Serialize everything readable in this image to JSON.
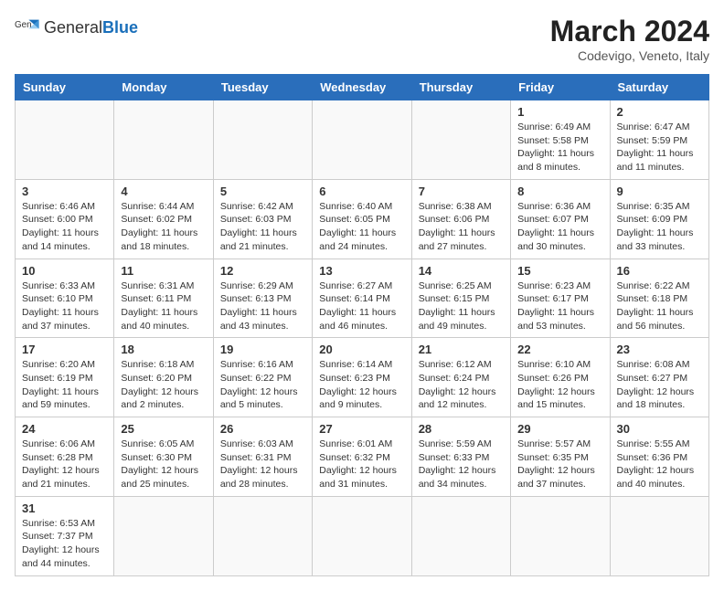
{
  "header": {
    "logo_general": "General",
    "logo_blue": "Blue",
    "month_title": "March 2024",
    "subtitle": "Codevigo, Veneto, Italy"
  },
  "weekdays": [
    "Sunday",
    "Monday",
    "Tuesday",
    "Wednesday",
    "Thursday",
    "Friday",
    "Saturday"
  ],
  "weeks": [
    [
      {
        "day": "",
        "info": ""
      },
      {
        "day": "",
        "info": ""
      },
      {
        "day": "",
        "info": ""
      },
      {
        "day": "",
        "info": ""
      },
      {
        "day": "",
        "info": ""
      },
      {
        "day": "1",
        "info": "Sunrise: 6:49 AM\nSunset: 5:58 PM\nDaylight: 11 hours and 8 minutes."
      },
      {
        "day": "2",
        "info": "Sunrise: 6:47 AM\nSunset: 5:59 PM\nDaylight: 11 hours and 11 minutes."
      }
    ],
    [
      {
        "day": "3",
        "info": "Sunrise: 6:46 AM\nSunset: 6:00 PM\nDaylight: 11 hours and 14 minutes."
      },
      {
        "day": "4",
        "info": "Sunrise: 6:44 AM\nSunset: 6:02 PM\nDaylight: 11 hours and 18 minutes."
      },
      {
        "day": "5",
        "info": "Sunrise: 6:42 AM\nSunset: 6:03 PM\nDaylight: 11 hours and 21 minutes."
      },
      {
        "day": "6",
        "info": "Sunrise: 6:40 AM\nSunset: 6:05 PM\nDaylight: 11 hours and 24 minutes."
      },
      {
        "day": "7",
        "info": "Sunrise: 6:38 AM\nSunset: 6:06 PM\nDaylight: 11 hours and 27 minutes."
      },
      {
        "day": "8",
        "info": "Sunrise: 6:36 AM\nSunset: 6:07 PM\nDaylight: 11 hours and 30 minutes."
      },
      {
        "day": "9",
        "info": "Sunrise: 6:35 AM\nSunset: 6:09 PM\nDaylight: 11 hours and 33 minutes."
      }
    ],
    [
      {
        "day": "10",
        "info": "Sunrise: 6:33 AM\nSunset: 6:10 PM\nDaylight: 11 hours and 37 minutes."
      },
      {
        "day": "11",
        "info": "Sunrise: 6:31 AM\nSunset: 6:11 PM\nDaylight: 11 hours and 40 minutes."
      },
      {
        "day": "12",
        "info": "Sunrise: 6:29 AM\nSunset: 6:13 PM\nDaylight: 11 hours and 43 minutes."
      },
      {
        "day": "13",
        "info": "Sunrise: 6:27 AM\nSunset: 6:14 PM\nDaylight: 11 hours and 46 minutes."
      },
      {
        "day": "14",
        "info": "Sunrise: 6:25 AM\nSunset: 6:15 PM\nDaylight: 11 hours and 49 minutes."
      },
      {
        "day": "15",
        "info": "Sunrise: 6:23 AM\nSunset: 6:17 PM\nDaylight: 11 hours and 53 minutes."
      },
      {
        "day": "16",
        "info": "Sunrise: 6:22 AM\nSunset: 6:18 PM\nDaylight: 11 hours and 56 minutes."
      }
    ],
    [
      {
        "day": "17",
        "info": "Sunrise: 6:20 AM\nSunset: 6:19 PM\nDaylight: 11 hours and 59 minutes."
      },
      {
        "day": "18",
        "info": "Sunrise: 6:18 AM\nSunset: 6:20 PM\nDaylight: 12 hours and 2 minutes."
      },
      {
        "day": "19",
        "info": "Sunrise: 6:16 AM\nSunset: 6:22 PM\nDaylight: 12 hours and 5 minutes."
      },
      {
        "day": "20",
        "info": "Sunrise: 6:14 AM\nSunset: 6:23 PM\nDaylight: 12 hours and 9 minutes."
      },
      {
        "day": "21",
        "info": "Sunrise: 6:12 AM\nSunset: 6:24 PM\nDaylight: 12 hours and 12 minutes."
      },
      {
        "day": "22",
        "info": "Sunrise: 6:10 AM\nSunset: 6:26 PM\nDaylight: 12 hours and 15 minutes."
      },
      {
        "day": "23",
        "info": "Sunrise: 6:08 AM\nSunset: 6:27 PM\nDaylight: 12 hours and 18 minutes."
      }
    ],
    [
      {
        "day": "24",
        "info": "Sunrise: 6:06 AM\nSunset: 6:28 PM\nDaylight: 12 hours and 21 minutes."
      },
      {
        "day": "25",
        "info": "Sunrise: 6:05 AM\nSunset: 6:30 PM\nDaylight: 12 hours and 25 minutes."
      },
      {
        "day": "26",
        "info": "Sunrise: 6:03 AM\nSunset: 6:31 PM\nDaylight: 12 hours and 28 minutes."
      },
      {
        "day": "27",
        "info": "Sunrise: 6:01 AM\nSunset: 6:32 PM\nDaylight: 12 hours and 31 minutes."
      },
      {
        "day": "28",
        "info": "Sunrise: 5:59 AM\nSunset: 6:33 PM\nDaylight: 12 hours and 34 minutes."
      },
      {
        "day": "29",
        "info": "Sunrise: 5:57 AM\nSunset: 6:35 PM\nDaylight: 12 hours and 37 minutes."
      },
      {
        "day": "30",
        "info": "Sunrise: 5:55 AM\nSunset: 6:36 PM\nDaylight: 12 hours and 40 minutes."
      }
    ],
    [
      {
        "day": "31",
        "info": "Sunrise: 6:53 AM\nSunset: 7:37 PM\nDaylight: 12 hours and 44 minutes."
      },
      {
        "day": "",
        "info": ""
      },
      {
        "day": "",
        "info": ""
      },
      {
        "day": "",
        "info": ""
      },
      {
        "day": "",
        "info": ""
      },
      {
        "day": "",
        "info": ""
      },
      {
        "day": "",
        "info": ""
      }
    ]
  ]
}
